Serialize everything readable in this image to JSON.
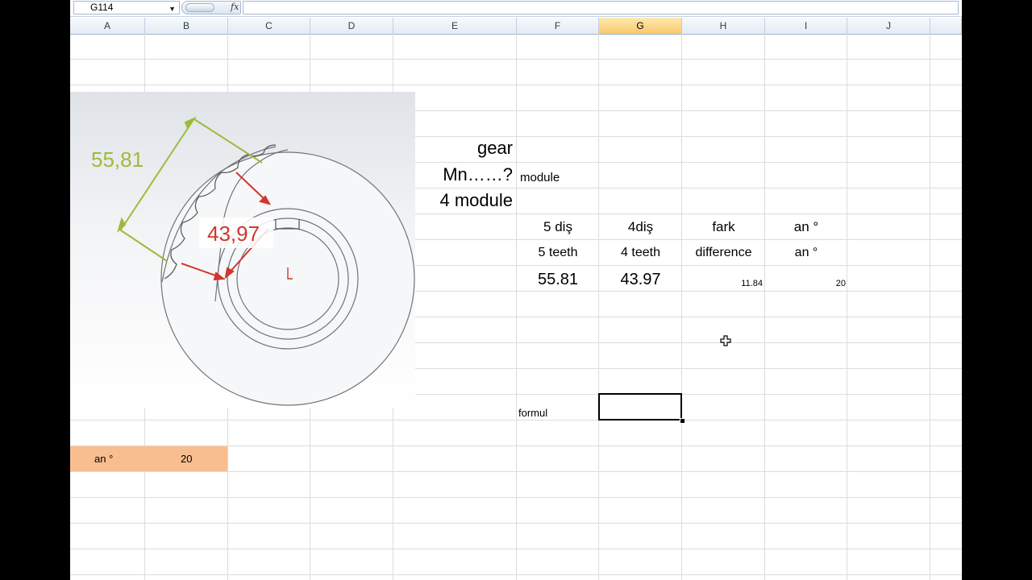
{
  "formula_bar": {
    "name_box": "G114",
    "fx_label": "fx",
    "formula": ""
  },
  "columns": [
    "A",
    "B",
    "C",
    "D",
    "E",
    "F",
    "G",
    "H",
    "I",
    "J"
  ],
  "selected_column": "G",
  "cells": {
    "E_gear": "gear",
    "E_mn": "Mn……?",
    "F_module": "module",
    "E_4module": "4 module",
    "F_5dis": "5 diş",
    "G_4dis": "4diş",
    "H_fark": "fark",
    "I_an1": "an °",
    "F_5teeth": "5 teeth",
    "G_4teeth": "4  teeth",
    "H_difference": "difference",
    "I_an2": "an °",
    "F_val": "55.81",
    "G_val": "43.97",
    "H_val": "11.84",
    "I_val": "20",
    "F_formul": "formul",
    "A_an": "an °",
    "B_20": "20"
  },
  "image": {
    "dim_outer": "55,81",
    "dim_inner": "43,97"
  },
  "colors": {
    "accent_green": "#9dbb3b",
    "accent_red": "#d0372e",
    "highlight_orange": "#f9be8f",
    "selected_header": "#f8c86a"
  }
}
